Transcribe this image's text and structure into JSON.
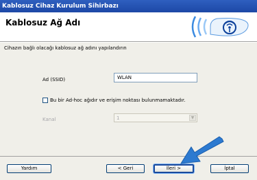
{
  "window": {
    "title": "Kablosuz Cihaz Kurulum Sihirbazı"
  },
  "header": {
    "title": "Kablosuz Ağ Adı",
    "logo_icon": "wireless-signal-icon"
  },
  "instruction": "Cihazın bağlı olacağı kablosuz ağ adını yapılandırın",
  "form": {
    "ssid_label": "Ad (SSID)",
    "ssid_value": "WLAN",
    "adhoc_checkbox_label": "Bu bir Ad-hoc ağıdır ve erişim noktası bulunmamaktadır.",
    "adhoc_checked": false,
    "channel_label": "Kanal",
    "channel_value": "1",
    "channel_disabled": true
  },
  "buttons": {
    "help": "Yardım",
    "back": "< Geri",
    "next": "İleri >",
    "cancel": "İptal"
  },
  "colors": {
    "accent": "#2d7ad0",
    "titlebar": "#1d48a6",
    "arrow": "#2d7ad0"
  }
}
